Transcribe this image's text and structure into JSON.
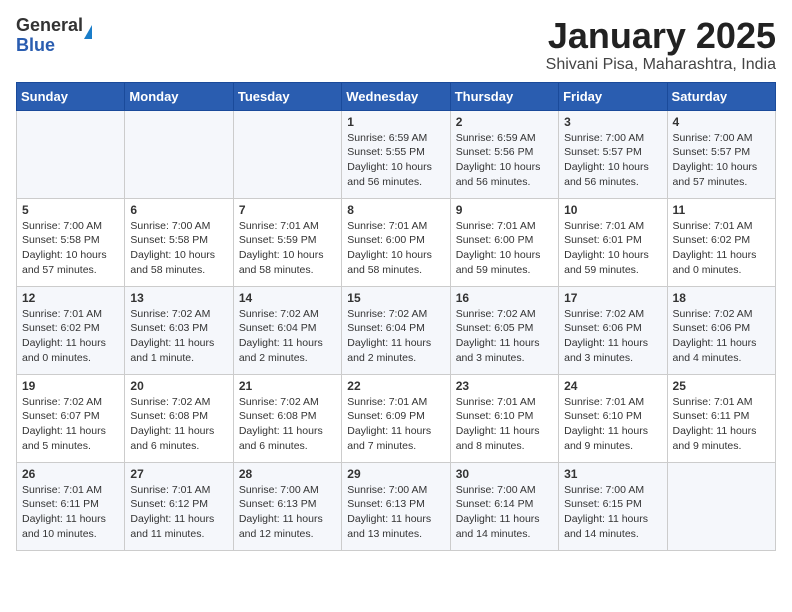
{
  "header": {
    "logo_general": "General",
    "logo_blue": "Blue",
    "title": "January 2025",
    "subtitle": "Shivani Pisa, Maharashtra, India"
  },
  "days_of_week": [
    "Sunday",
    "Monday",
    "Tuesday",
    "Wednesday",
    "Thursday",
    "Friday",
    "Saturday"
  ],
  "weeks": [
    [
      {
        "day": "",
        "info": ""
      },
      {
        "day": "",
        "info": ""
      },
      {
        "day": "",
        "info": ""
      },
      {
        "day": "1",
        "info": "Sunrise: 6:59 AM\nSunset: 5:55 PM\nDaylight: 10 hours\nand 56 minutes."
      },
      {
        "day": "2",
        "info": "Sunrise: 6:59 AM\nSunset: 5:56 PM\nDaylight: 10 hours\nand 56 minutes."
      },
      {
        "day": "3",
        "info": "Sunrise: 7:00 AM\nSunset: 5:57 PM\nDaylight: 10 hours\nand 56 minutes."
      },
      {
        "day": "4",
        "info": "Sunrise: 7:00 AM\nSunset: 5:57 PM\nDaylight: 10 hours\nand 57 minutes."
      }
    ],
    [
      {
        "day": "5",
        "info": "Sunrise: 7:00 AM\nSunset: 5:58 PM\nDaylight: 10 hours\nand 57 minutes."
      },
      {
        "day": "6",
        "info": "Sunrise: 7:00 AM\nSunset: 5:58 PM\nDaylight: 10 hours\nand 58 minutes."
      },
      {
        "day": "7",
        "info": "Sunrise: 7:01 AM\nSunset: 5:59 PM\nDaylight: 10 hours\nand 58 minutes."
      },
      {
        "day": "8",
        "info": "Sunrise: 7:01 AM\nSunset: 6:00 PM\nDaylight: 10 hours\nand 58 minutes."
      },
      {
        "day": "9",
        "info": "Sunrise: 7:01 AM\nSunset: 6:00 PM\nDaylight: 10 hours\nand 59 minutes."
      },
      {
        "day": "10",
        "info": "Sunrise: 7:01 AM\nSunset: 6:01 PM\nDaylight: 10 hours\nand 59 minutes."
      },
      {
        "day": "11",
        "info": "Sunrise: 7:01 AM\nSunset: 6:02 PM\nDaylight: 11 hours\nand 0 minutes."
      }
    ],
    [
      {
        "day": "12",
        "info": "Sunrise: 7:01 AM\nSunset: 6:02 PM\nDaylight: 11 hours\nand 0 minutes."
      },
      {
        "day": "13",
        "info": "Sunrise: 7:02 AM\nSunset: 6:03 PM\nDaylight: 11 hours\nand 1 minute."
      },
      {
        "day": "14",
        "info": "Sunrise: 7:02 AM\nSunset: 6:04 PM\nDaylight: 11 hours\nand 2 minutes."
      },
      {
        "day": "15",
        "info": "Sunrise: 7:02 AM\nSunset: 6:04 PM\nDaylight: 11 hours\nand 2 minutes."
      },
      {
        "day": "16",
        "info": "Sunrise: 7:02 AM\nSunset: 6:05 PM\nDaylight: 11 hours\nand 3 minutes."
      },
      {
        "day": "17",
        "info": "Sunrise: 7:02 AM\nSunset: 6:06 PM\nDaylight: 11 hours\nand 3 minutes."
      },
      {
        "day": "18",
        "info": "Sunrise: 7:02 AM\nSunset: 6:06 PM\nDaylight: 11 hours\nand 4 minutes."
      }
    ],
    [
      {
        "day": "19",
        "info": "Sunrise: 7:02 AM\nSunset: 6:07 PM\nDaylight: 11 hours\nand 5 minutes."
      },
      {
        "day": "20",
        "info": "Sunrise: 7:02 AM\nSunset: 6:08 PM\nDaylight: 11 hours\nand 6 minutes."
      },
      {
        "day": "21",
        "info": "Sunrise: 7:02 AM\nSunset: 6:08 PM\nDaylight: 11 hours\nand 6 minutes."
      },
      {
        "day": "22",
        "info": "Sunrise: 7:01 AM\nSunset: 6:09 PM\nDaylight: 11 hours\nand 7 minutes."
      },
      {
        "day": "23",
        "info": "Sunrise: 7:01 AM\nSunset: 6:10 PM\nDaylight: 11 hours\nand 8 minutes."
      },
      {
        "day": "24",
        "info": "Sunrise: 7:01 AM\nSunset: 6:10 PM\nDaylight: 11 hours\nand 9 minutes."
      },
      {
        "day": "25",
        "info": "Sunrise: 7:01 AM\nSunset: 6:11 PM\nDaylight: 11 hours\nand 9 minutes."
      }
    ],
    [
      {
        "day": "26",
        "info": "Sunrise: 7:01 AM\nSunset: 6:11 PM\nDaylight: 11 hours\nand 10 minutes."
      },
      {
        "day": "27",
        "info": "Sunrise: 7:01 AM\nSunset: 6:12 PM\nDaylight: 11 hours\nand 11 minutes."
      },
      {
        "day": "28",
        "info": "Sunrise: 7:00 AM\nSunset: 6:13 PM\nDaylight: 11 hours\nand 12 minutes."
      },
      {
        "day": "29",
        "info": "Sunrise: 7:00 AM\nSunset: 6:13 PM\nDaylight: 11 hours\nand 13 minutes."
      },
      {
        "day": "30",
        "info": "Sunrise: 7:00 AM\nSunset: 6:14 PM\nDaylight: 11 hours\nand 14 minutes."
      },
      {
        "day": "31",
        "info": "Sunrise: 7:00 AM\nSunset: 6:15 PM\nDaylight: 11 hours\nand 14 minutes."
      },
      {
        "day": "",
        "info": ""
      }
    ]
  ]
}
